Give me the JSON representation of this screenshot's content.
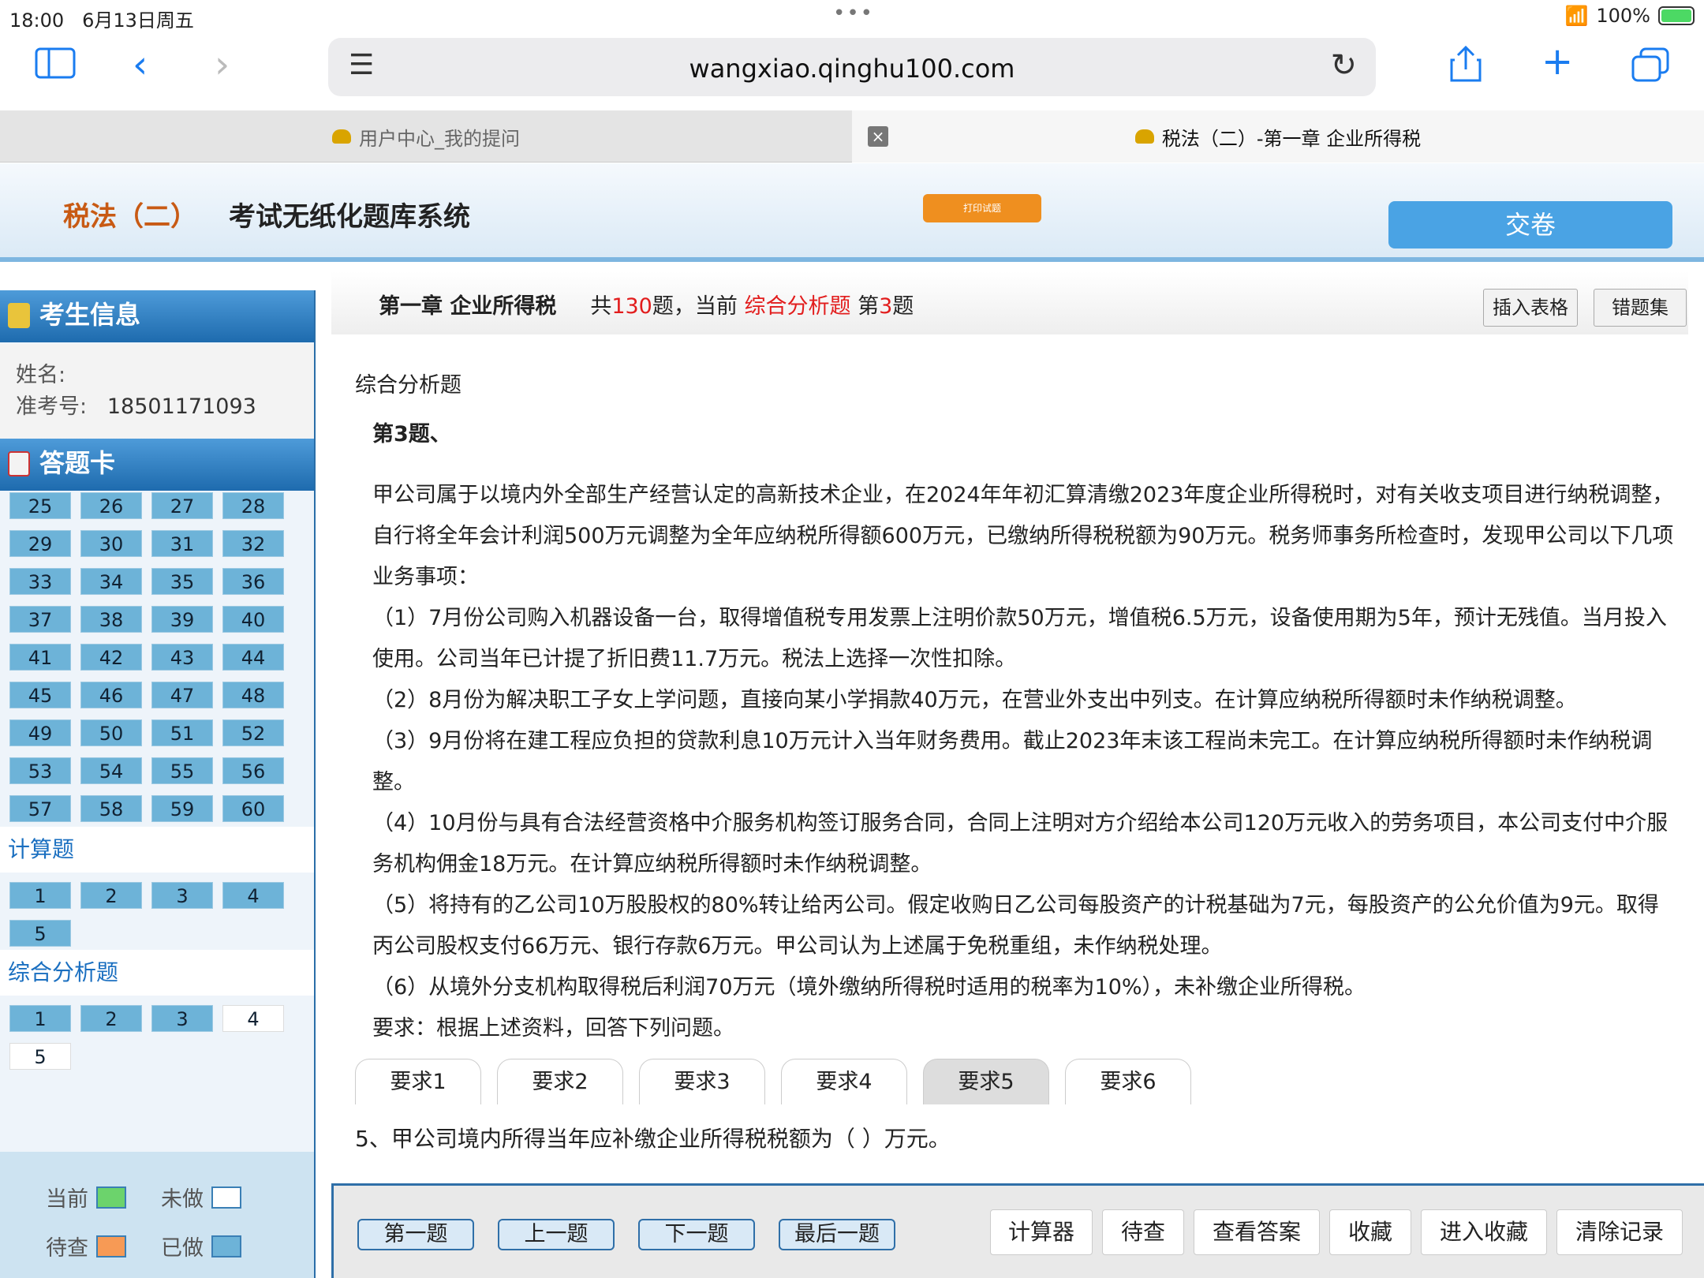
{
  "status": {
    "time": "18:00",
    "date": "6月13日周五",
    "battery": "100%"
  },
  "browser": {
    "url": "wangxiao.qinghu100.com"
  },
  "tabs": [
    {
      "label": "用户中心_我的提问"
    },
    {
      "label": "税法（二）-第一章 企业所得税"
    }
  ],
  "header": {
    "subject": "税法（二）",
    "system": "考试无纸化题库系统",
    "print": "打印试题",
    "submit": "交卷"
  },
  "sidebar": {
    "info_title": "考生信息",
    "name_label": "姓名:",
    "id_label": "准考号:",
    "id_value": "18501171093",
    "card_title": "答题卡",
    "choice_numbers": [
      "25",
      "26",
      "27",
      "28",
      "29",
      "30",
      "31",
      "32",
      "33",
      "34",
      "35",
      "36",
      "37",
      "38",
      "39",
      "40",
      "41",
      "42",
      "43",
      "44",
      "45",
      "46",
      "47",
      "48",
      "49",
      "50",
      "51",
      "52",
      "53",
      "54",
      "55",
      "56",
      "57",
      "58",
      "59",
      "60"
    ],
    "calc_label": "计算题",
    "calc_numbers": [
      "1",
      "2",
      "3",
      "4",
      "5"
    ],
    "analysis_label": "综合分析题",
    "analysis_numbers": [
      "1",
      "2",
      "3",
      "4",
      "5"
    ],
    "legend": {
      "current": "当前",
      "undone": "未做",
      "pending": "待查",
      "done": "已做"
    }
  },
  "qhead": {
    "chapter": "第一章 企业所得税",
    "total_pre": "共",
    "total": "130",
    "total_post": "题，当前",
    "type": "综合分析题",
    "no_pre": "第",
    "no": "3",
    "no_post": "题",
    "insert_table": "插入表格",
    "wrong_set": "错题集"
  },
  "question": {
    "type": "综合分析题",
    "number": "第3题、",
    "paragraphs": [
      "甲公司属于以境内外全部生产经营认定的高新技术企业，在2024年年初汇算清缴2023年度企业所得税时，对有关收支项目进行纳税调整，自行将全年会计利润500万元调整为全年应纳税所得额600万元，已缴纳所得税税额为90万元。税务师事务所检查时，发现甲公司以下几项业务事项：",
      "（1）7月份公司购入机器设备一台，取得增值税专用发票上注明价款50万元，增值税6.5万元，设备使用期为5年，预计无残值。当月投入使用。公司当年已计提了折旧费11.7万元。税法上选择一次性扣除。",
      "（2）8月份为解决职工子女上学问题，直接向某小学捐款40万元，在营业外支出中列支。在计算应纳税所得额时未作纳税调整。",
      "（3）9月份将在建工程应负担的贷款利息10万元计入当年财务费用。截止2023年末该工程尚未完工。在计算应纳税所得额时未作纳税调整。",
      "（4）10月份与具有合法经营资格中介服务机构签订服务合同，合同上注明对方介绍给本公司120万元收入的劳务项目，本公司支付中介服务机构佣金18万元。在计算应纳税所得额时未作纳税调整。",
      "（5）将持有的乙公司10万股股权的80%转让给丙公司。假定收购日乙公司每股资产的计税基础为7元，每股资产的公允价值为9元。取得丙公司股权支付66万元、银行存款6万元。甲公司认为上述属于免税重组，未作纳税处理。",
      "（6）从境外分支机构取得税后利润70万元（境外缴纳所得税时适用的税率为10%），未补缴企业所得税。",
      "要求：根据上述资料，回答下列问题。"
    ],
    "req_tabs": [
      "要求1",
      "要求2",
      "要求3",
      "要求4",
      "要求5",
      "要求6"
    ],
    "sub_question": "5、甲公司境内所得当年应补缴企业所得税税额为（    ）万元。"
  },
  "bottom": {
    "first": "第一题",
    "prev": "上一题",
    "next": "下一题",
    "last": "最后一题",
    "calculator": "计算器",
    "pending": "待查",
    "answer": "查看答案",
    "fav": "收藏",
    "enter_fav": "进入收藏",
    "clear": "清除记录"
  },
  "colors": {
    "current": "#6cd36c",
    "undone": "#ffffff",
    "pending": "#f79a55",
    "done": "#6db3d8",
    "accent": "#4aa3e4"
  }
}
